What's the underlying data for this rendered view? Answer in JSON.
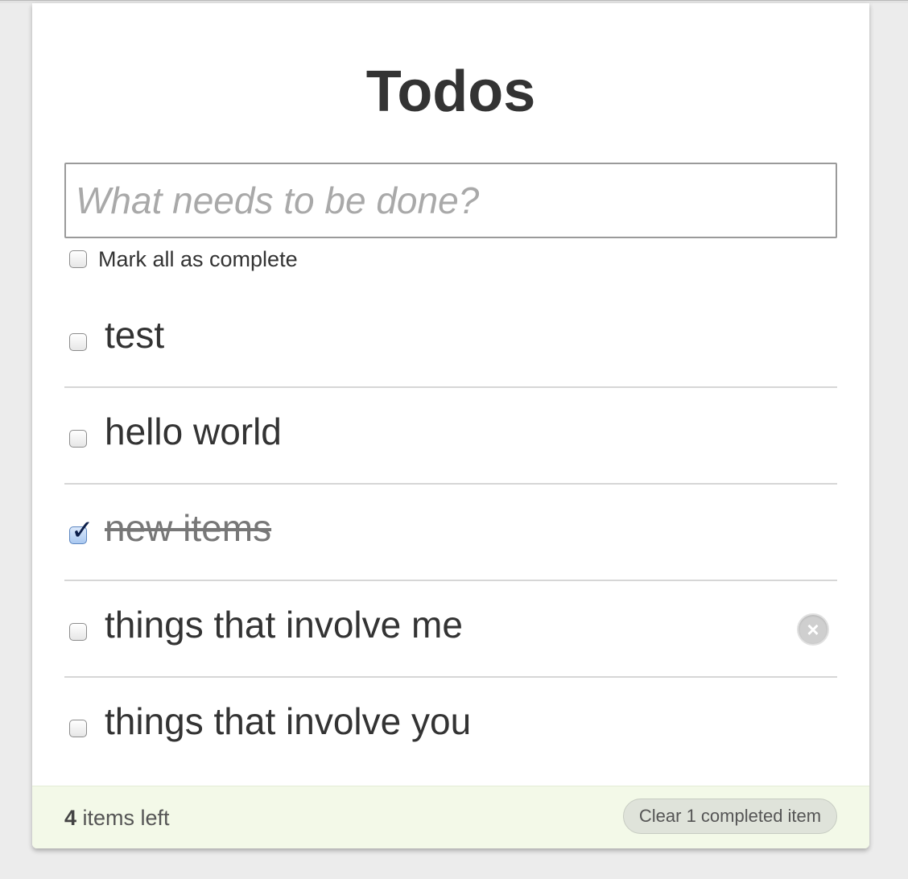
{
  "app": {
    "title": "Todos",
    "new_todo_placeholder": "What needs to be done?",
    "mark_all_label": "Mark all as complete"
  },
  "todos": [
    {
      "text": "test",
      "completed": false
    },
    {
      "text": "hello world",
      "completed": false
    },
    {
      "text": "new items",
      "completed": true
    },
    {
      "text": "things that involve me",
      "completed": false,
      "hovered": true
    },
    {
      "text": "things that involve you",
      "completed": false
    }
  ],
  "footer": {
    "remaining_count": "4",
    "remaining_suffix": " items left",
    "clear_label": "Clear 1 completed item"
  },
  "colors": {
    "footer_bg": "#f3f9e8",
    "text": "#333333",
    "completed_text": "#777777"
  },
  "icons": {
    "destroy": "close-circle-icon",
    "check": "checkmark-icon"
  }
}
